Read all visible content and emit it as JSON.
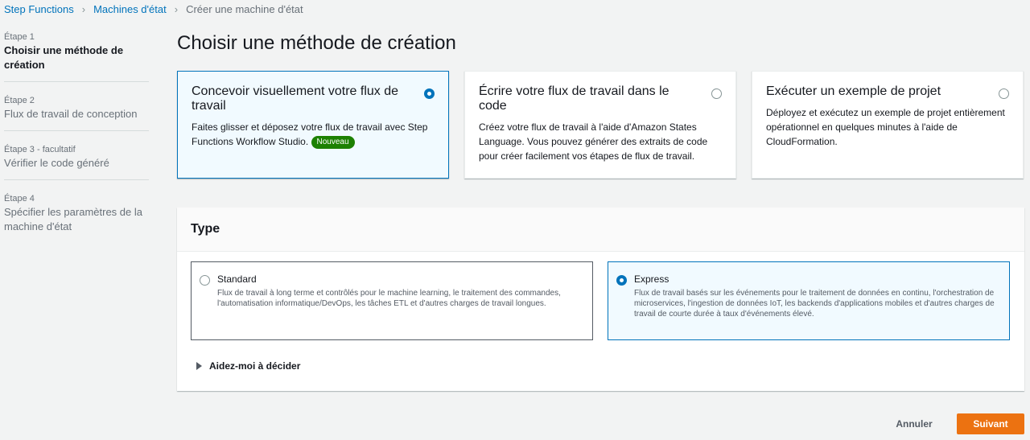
{
  "breadcrumb": {
    "items": [
      "Step Functions",
      "Machines d'état"
    ],
    "current": "Créer une machine d'état"
  },
  "steps": [
    {
      "number": "Étape 1",
      "title": "Choisir une méthode de création",
      "active": true
    },
    {
      "number": "Étape 2",
      "title": "Flux de travail de conception",
      "active": false
    },
    {
      "number": "Étape 3 - facultatif",
      "title": "Vérifier le code généré",
      "active": false
    },
    {
      "number": "Étape 4",
      "title": "Spécifier les paramètres de la machine d'état",
      "active": false
    }
  ],
  "page_title": "Choisir une méthode de création",
  "methods": [
    {
      "title": "Concevoir visuellement votre flux de travail",
      "description": "Faites glisser et déposez votre flux de travail avec Step Functions Workflow Studio.",
      "badge": "Nouveau",
      "selected": true
    },
    {
      "title": "Écrire votre flux de travail dans le code",
      "description": "Créez votre flux de travail à l'aide d'Amazon States Language. Vous pouvez générer des extraits de code pour créer facilement vos étapes de flux de travail.",
      "selected": false
    },
    {
      "title": "Exécuter un exemple de projet",
      "description": "Déployez et exécutez un exemple de projet entièrement opérationnel en quelques minutes à l'aide de CloudFormation.",
      "selected": false
    }
  ],
  "type_panel": {
    "header": "Type",
    "options": [
      {
        "title": "Standard",
        "description": "Flux de travail à long terme et contrôlés pour le machine learning, le traitement des commandes, l'automatisation informatique/DevOps, les tâches ETL et d'autres charges de travail longues.",
        "selected": false
      },
      {
        "title": "Express",
        "description": "Flux de travail basés sur les événements pour le traitement de données en continu, l'orchestration de microservices, l'ingestion de données IoT, les backends d'applications mobiles et d'autres charges de travail de courte durée à taux d'événements élevé.",
        "selected": true
      }
    ],
    "help_label": "Aidez-moi à décider"
  },
  "footer": {
    "cancel_label": "Annuler",
    "next_label": "Suivant"
  },
  "colors": {
    "accent": "#0073bb",
    "primary_button": "#ec7211",
    "badge": "#1d8102"
  }
}
